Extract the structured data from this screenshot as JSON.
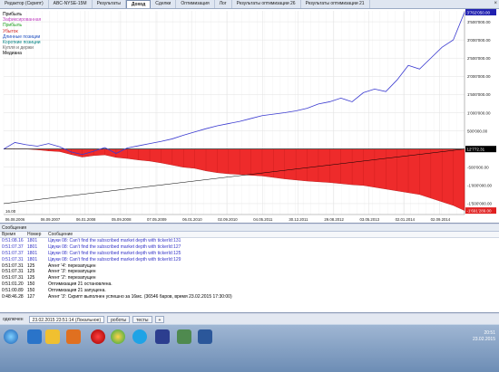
{
  "tabs": [
    {
      "label": "Редактор (Скрипт)",
      "active": false
    },
    {
      "label": "ABC-NYSE-15M",
      "active": false
    },
    {
      "label": "Результаты",
      "active": false
    },
    {
      "label": "Доход",
      "active": true
    },
    {
      "label": "Сделки",
      "active": false
    },
    {
      "label": "Оптимизация",
      "active": false
    },
    {
      "label": "Лог",
      "active": false
    },
    {
      "label": "Результаты оптимизации 26",
      "active": false
    },
    {
      "label": "Результаты оптимизации 21",
      "active": false
    }
  ],
  "legend": [
    {
      "label": "Прибыль",
      "color": "#000000"
    },
    {
      "label": "Зафиксированная",
      "color": "#c040c0"
    },
    {
      "label": "Прибыль",
      "color": "#20a020"
    },
    {
      "label": "Убыток",
      "color": "#d02020"
    },
    {
      "label": "Длинные позиции",
      "color": "#2050c0"
    },
    {
      "label": "Короткие позиции",
      "color": "#008080"
    },
    {
      "label": "Купля и держи",
      "color": "#606060"
    },
    {
      "label": "Медиана",
      "color": "#000000"
    }
  ],
  "chart_data": {
    "type": "line",
    "xlabel": "",
    "ylabel": "",
    "x_ticks": [
      "06.08.2006",
      "06.09.2007",
      "06.01.2008",
      "05.09.2008",
      "07.05.2009",
      "06.01.2010",
      "02.09.2010",
      "04.05.2011",
      "30.12.2011",
      "29.08.2012",
      "03.05.2013",
      "02.01.2014",
      "02.09.2014"
    ],
    "y_ticks": [
      "3'500'000.00",
      "3'000'000.00",
      "2'500'000.00",
      "2'000'000.00",
      "1'500'000.00",
      "1'000'000.00",
      "500'000.00",
      "0.00",
      "-500'000.00",
      "-1'000'000.00",
      "-1'500'000.00"
    ],
    "ylim": [
      -1800000,
      3800000
    ],
    "current_equity_label": "3'762'050.00",
    "current_zero_label": "12'772.31",
    "current_drawdown_label": "-1'691'289.00",
    "corner_label": "16.00",
    "series": [
      {
        "name": "Прибыль",
        "color": "#3a3ad0",
        "values": [
          0,
          180000,
          120000,
          80000,
          150000,
          60000,
          -80000,
          -150000,
          -60000,
          40000,
          -120000,
          30000,
          90000,
          150000,
          210000,
          280000,
          380000,
          470000,
          560000,
          640000,
          700000,
          760000,
          840000,
          920000,
          960000,
          1000000,
          1050000,
          1120000,
          1240000,
          1300000,
          1400000,
          1300000,
          1550000,
          1650000,
          1580000,
          1900000,
          2300000,
          2200000,
          2500000,
          2800000,
          3000000,
          3762050
        ]
      },
      {
        "name": "Убыток",
        "color": "#e03030",
        "values": [
          0,
          0,
          0,
          -20000,
          -50000,
          -70000,
          -150000,
          -220000,
          -180000,
          -160000,
          -230000,
          -260000,
          -300000,
          -330000,
          -380000,
          -440000,
          -500000,
          -530000,
          -600000,
          -650000,
          -680000,
          -700000,
          -720000,
          -740000,
          -780000,
          -820000,
          -850000,
          -880000,
          -900000,
          -920000,
          -950000,
          -980000,
          -1000000,
          -1050000,
          -1100000,
          -1150000,
          -1200000,
          -1250000,
          -1350000,
          -1450000,
          -1550000,
          -1691289
        ]
      },
      {
        "name": "Купля и держи",
        "color": "#000000",
        "values": [
          -1500000,
          0
        ]
      }
    ]
  },
  "messages": {
    "title": "Сообщения",
    "columns": [
      "Время",
      "Номер",
      "Сообщение"
    ],
    "rows": [
      {
        "time": "0:51:08.16",
        "num": "1801",
        "text": "Цвуки 08: Can't find the subscribed market depth with tickerId:131",
        "blue": true
      },
      {
        "time": "0:51:07.37",
        "num": "1801",
        "text": "Цвуки 08: Can't find the subscribed market depth with tickerId:127",
        "blue": true
      },
      {
        "time": "0:51:07.37",
        "num": "1801",
        "text": "Цвуки 08: Can't find the subscribed market depth with tickerId:125",
        "blue": true
      },
      {
        "time": "0:51:07.31",
        "num": "1801",
        "text": "Цвуки 08: Can't find the subscribed market depth with tickerId:129",
        "blue": true
      },
      {
        "time": "0:51:07.31",
        "num": "125",
        "text": "Агент '4': перезапущен",
        "blue": false
      },
      {
        "time": "0:51:07.31",
        "num": "125",
        "text": "Агент '3': перезапущен",
        "blue": false
      },
      {
        "time": "0:51:07.31",
        "num": "125",
        "text": "Агент '2': перезапущен",
        "blue": false
      },
      {
        "time": "0:51:01.20",
        "num": "150",
        "text": "Оптимизация 21 остановлена.",
        "blue": false
      },
      {
        "time": "0:51:00.89",
        "num": "150",
        "text": "Оптимизация 21 запущена.",
        "blue": false
      },
      {
        "time": "0:48:46.28",
        "num": "127",
        "text": "Агент '3': Скрипт выполнен успешно за 16мс. (36546 баров, время 23.02.2015 17:30:00)",
        "blue": false
      }
    ]
  },
  "statusbar": {
    "left": "одключен",
    "time": "23.02.2015 23:51:14 (Локальное)",
    "robots": "роботы",
    "tests": "тесты"
  },
  "tray": {
    "time": "20:51",
    "date": "23.02.2015"
  }
}
